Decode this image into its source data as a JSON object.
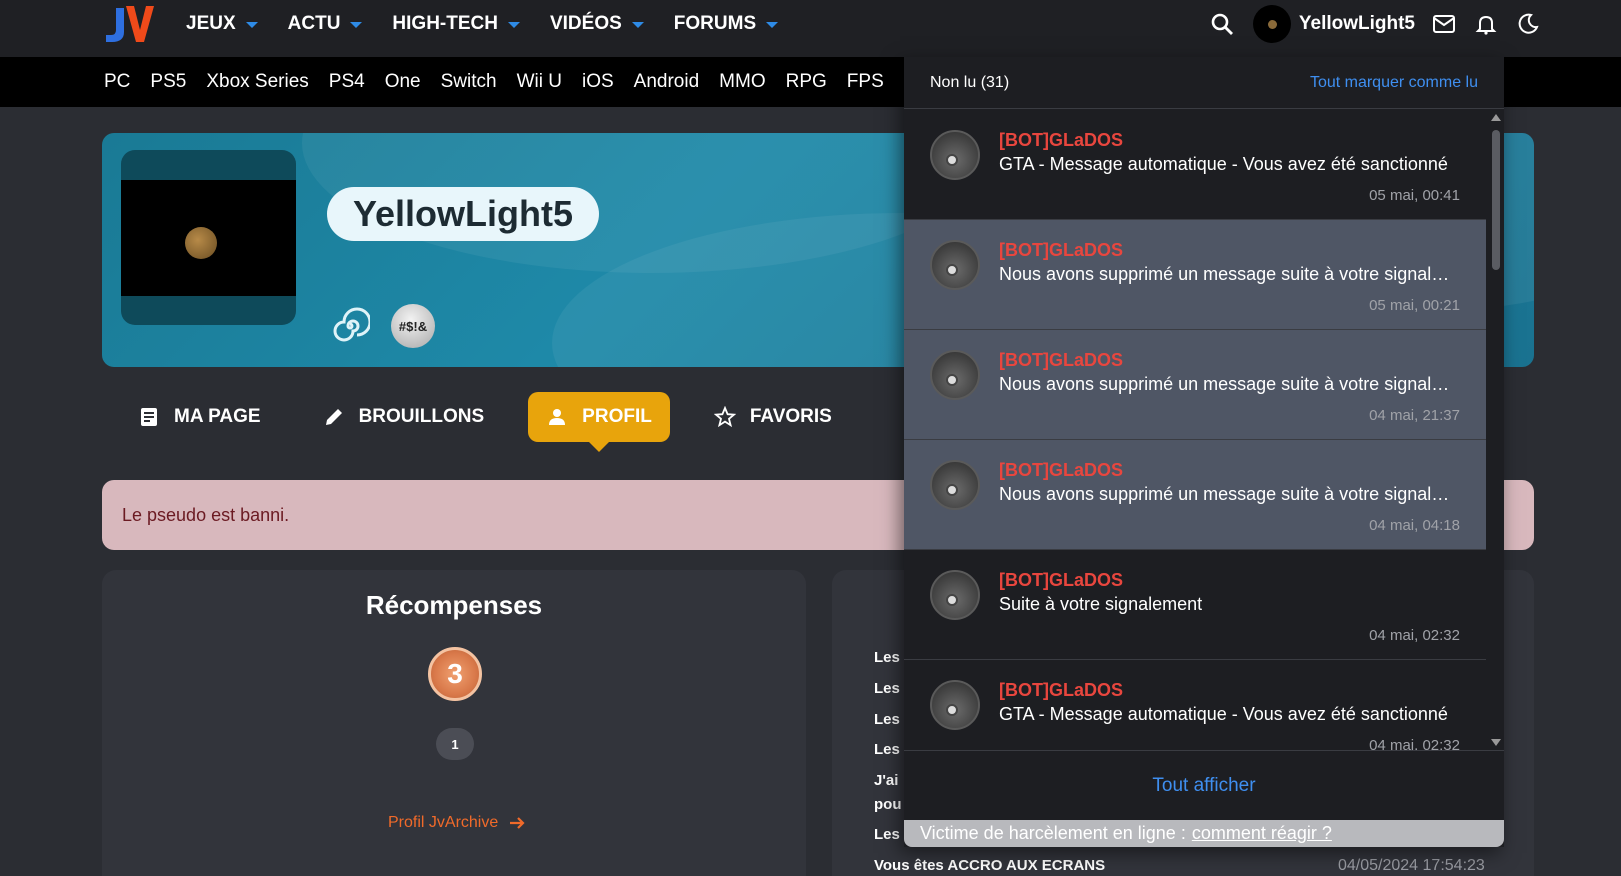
{
  "header": {
    "nav": [
      {
        "label": "JEUX"
      },
      {
        "label": "ACTU"
      },
      {
        "label": "HIGH-TECH"
      },
      {
        "label": "VIDÉOS"
      },
      {
        "label": "FORUMS"
      }
    ],
    "username": "YellowLight5",
    "icons": [
      "search-icon",
      "avatar",
      "mail-icon",
      "bell-icon",
      "moon-icon"
    ]
  },
  "platforms": [
    "PC",
    "PS5",
    "Xbox Series",
    "PS4",
    "One",
    "Switch",
    "Wii U",
    "iOS",
    "Android",
    "MMO",
    "RPG",
    "FPS"
  ],
  "profile": {
    "pseudo": "YellowLight5",
    "badge2_text": "#$!&",
    "tabs": [
      {
        "label": "MA PAGE",
        "icon": "page-icon"
      },
      {
        "label": "BROUILLONS",
        "icon": "pencil-icon"
      },
      {
        "label": "PROFIL",
        "icon": "person-icon",
        "active": true
      },
      {
        "label": "FAVORIS",
        "icon": "star-icon"
      }
    ],
    "alert": "Le pseudo est banni."
  },
  "rewards": {
    "title": "Récompenses",
    "medal_value": "3",
    "count": "1",
    "link": "Profil JvArchive"
  },
  "right_panel": {
    "lines": [
      "Les",
      "Les",
      "Les",
      "Les",
      "J'ai",
      "pou",
      "Les",
      "Vous êtes ACCRO AUX ECRANS"
    ],
    "date": "04/05/2024 17:54:23"
  },
  "notifications": {
    "unread_label": "Non lu (31)",
    "mark_all": "Tout marquer comme lu",
    "items": [
      {
        "from": "[BOT]GLaDOS",
        "message": "GTA - Message automatique - Vous avez été sanctionné",
        "time": "05 mai, 00:41",
        "highlight": false
      },
      {
        "from": "[BOT]GLaDOS",
        "message": "Nous avons supprimé un message suite à votre signalement",
        "time": "05 mai, 00:21",
        "highlight": true
      },
      {
        "from": "[BOT]GLaDOS",
        "message": "Nous avons supprimé un message suite à votre signalement",
        "time": "04 mai, 21:37",
        "highlight": true
      },
      {
        "from": "[BOT]GLaDOS",
        "message": "Nous avons supprimé un message suite à votre signalement",
        "time": "04 mai, 04:18",
        "highlight": true
      },
      {
        "from": "[BOT]GLaDOS",
        "message": "Suite à votre signalement",
        "time": "04 mai, 02:32",
        "highlight": false
      },
      {
        "from": "[BOT]GLaDOS",
        "message": "GTA - Message automatique - Vous avez été sanctionné",
        "time": "04 mai, 02:32",
        "highlight": false
      }
    ],
    "show_all": "Tout afficher",
    "harassment_text": "Victime de harcèlement en ligne :",
    "harassment_link": "comment réagir ?"
  },
  "colors": {
    "accent_blue": "#2e8be6",
    "active_tab": "#e8a40c",
    "bot_red": "#e8463e",
    "link_blue": "#3f8ff0",
    "jvarchive_orange": "#f06a2a"
  }
}
